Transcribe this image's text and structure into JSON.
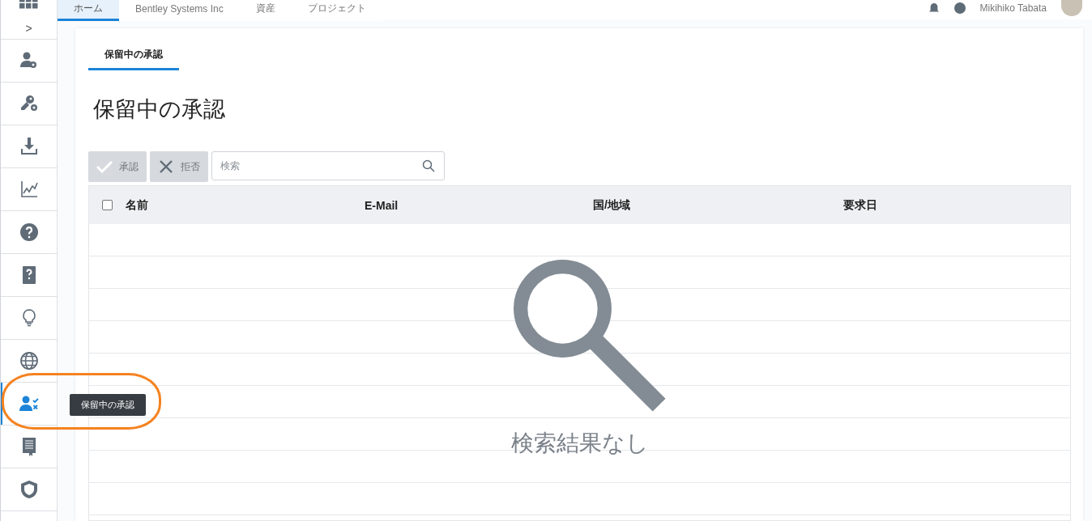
{
  "top_nav": {
    "tabs": [
      {
        "label": "ホーム",
        "selected": true
      },
      {
        "label": "Bentley Systems Inc",
        "selected": false
      },
      {
        "label": "資産",
        "selected": false
      },
      {
        "label": "プロジェクト",
        "selected": false
      }
    ],
    "user_name": "Mikihiko Tabata"
  },
  "sidebar": {
    "expand_label": ">",
    "items": [
      {
        "selected": false
      },
      {
        "selected": false
      },
      {
        "selected": false
      },
      {
        "selected": false
      },
      {
        "selected": false
      },
      {
        "selected": false
      },
      {
        "selected": false
      },
      {
        "selected": false
      },
      {
        "selected": true,
        "tooltip": "保留中の承認"
      },
      {
        "selected": false
      },
      {
        "selected": false
      }
    ]
  },
  "page": {
    "tabs": [
      {
        "label": "保留中の承認",
        "selected": true
      }
    ],
    "title": "保留中の承認",
    "toolbar": {
      "buttons": [
        {
          "kind": "approve",
          "label": "承認",
          "disabled": true
        },
        {
          "kind": "reject",
          "label": "拒否",
          "disabled": true
        }
      ],
      "search": {
        "placeholder": "検索"
      }
    },
    "table": {
      "select_all": {
        "checked": false
      },
      "columns": [
        "名前",
        "E-Mail",
        "国/地域",
        "要求日"
      ],
      "empty_message": "検索結果なし"
    }
  }
}
